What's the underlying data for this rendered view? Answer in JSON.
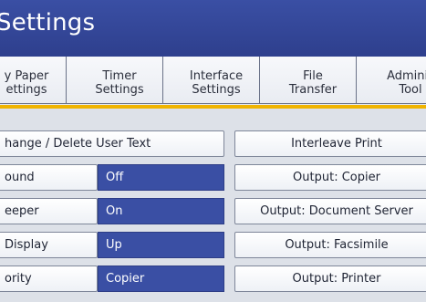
{
  "window": {
    "title": "Settings"
  },
  "tabs": [
    {
      "line1": "y Paper",
      "line2": "ettings"
    },
    {
      "line1": "Timer",
      "line2": "Settings"
    },
    {
      "line1": "Interface",
      "line2": "Settings"
    },
    {
      "line1": "File",
      "line2": "Transfer"
    },
    {
      "line1": "Adminis",
      "line2": "Tool"
    }
  ],
  "left": {
    "change_delete": "hange / Delete User Text",
    "rows": [
      {
        "label": "ound",
        "value": "Off"
      },
      {
        "label": "eeper",
        "value": "On"
      },
      {
        "label": "Display",
        "value": "Up"
      },
      {
        "label": "ority",
        "value": "Copier"
      }
    ]
  },
  "right": [
    "Interleave Print",
    "Output: Copier",
    "Output: Document Server",
    "Output: Facsimile",
    "Output: Printer"
  ],
  "colors": {
    "titlebar": "#3a4fa4",
    "value_bg": "#3a4fa4",
    "tab_underline": "#f0b400"
  }
}
